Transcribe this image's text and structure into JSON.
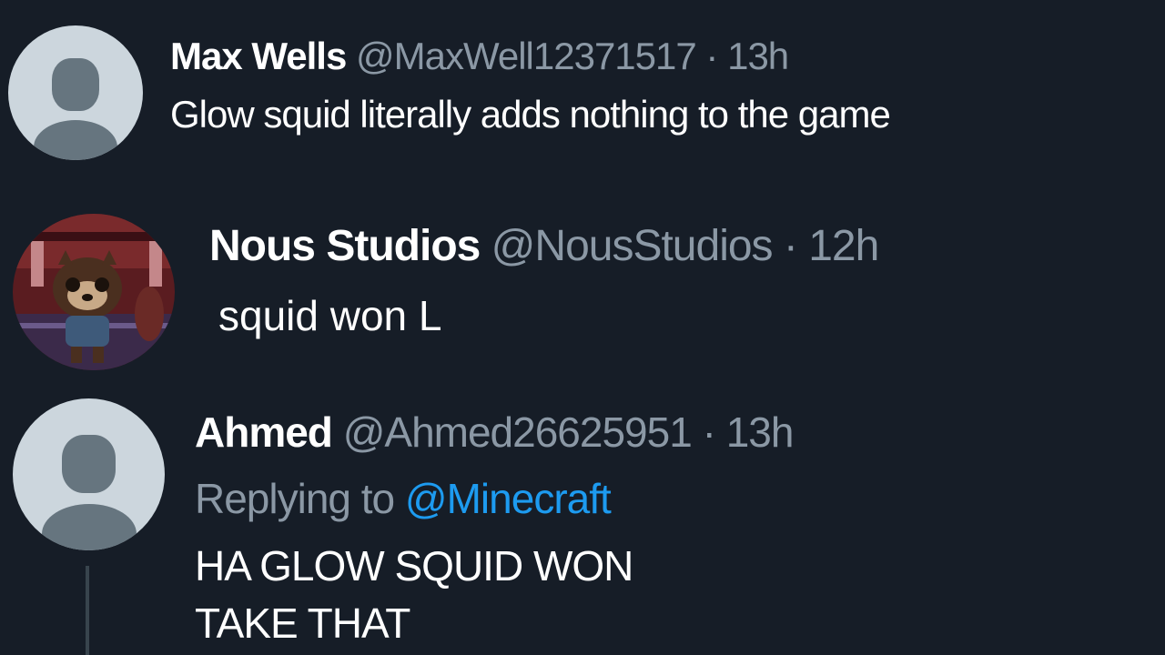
{
  "tweets": [
    {
      "display_name": "Max Wells",
      "handle": "@MaxWell12371517",
      "separator": "·",
      "time": "13h",
      "text": "Glow squid literally adds nothing to the game",
      "avatar": "default-avatar-icon"
    },
    {
      "display_name": "Nous Studios",
      "handle": "@NousStudios",
      "separator": "·",
      "time": "12h",
      "text": "squid won L",
      "avatar": "profile-photo"
    },
    {
      "display_name": "Ahmed",
      "handle": "@Ahmed26625951",
      "separator": "·",
      "time": "13h",
      "replying_label": "Replying to",
      "replying_to": "@Minecraft",
      "text_lines": [
        "HA GLOW SQUID WON",
        "TAKE THAT"
      ],
      "avatar": "default-avatar-icon"
    }
  ],
  "colors": {
    "background": "#161d27",
    "name": "#ffffff",
    "muted": "#8b98a5",
    "mention": "#1d9bf0",
    "avatar_bg": "#ccd6dd",
    "avatar_fg": "#66757f"
  }
}
